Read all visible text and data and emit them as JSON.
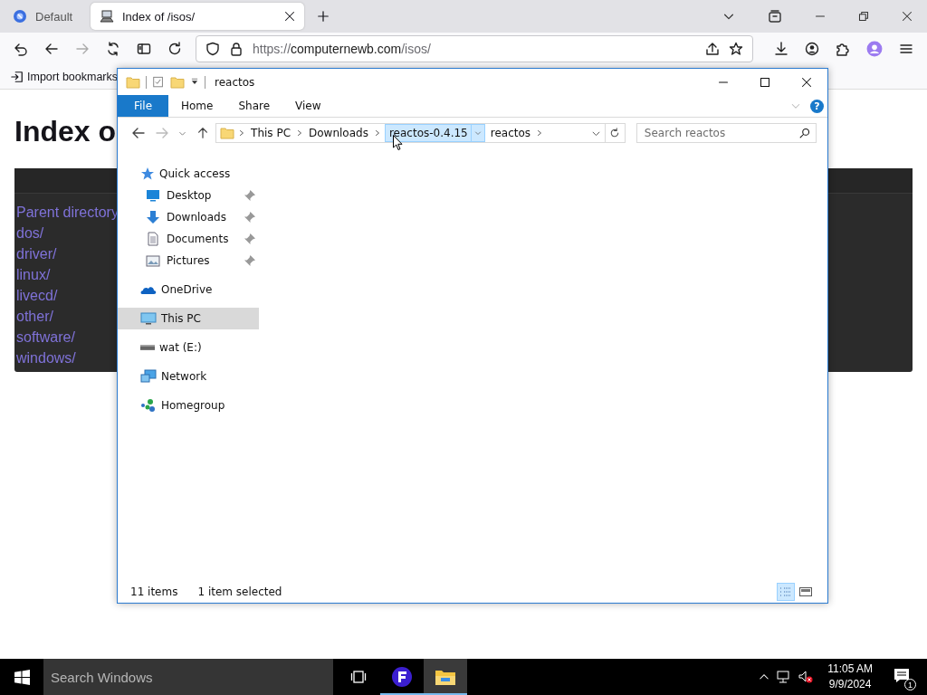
{
  "browser": {
    "tabs": [
      {
        "kind": "browser",
        "label": "Default",
        "selected": false
      },
      {
        "kind": "site",
        "label": "Index of /isos/",
        "selected": true
      }
    ],
    "nav_buttons": [
      {
        "kind": "back",
        "disabled": false
      },
      {
        "kind": "forward",
        "disabled": true
      }
    ],
    "address": {
      "scheme": "https://",
      "host": "computernewb.com",
      "path": "/isos/"
    },
    "bookmarks": [
      "Import bookmarks"
    ],
    "page": {
      "heading": "Index o",
      "links": [
        "Parent directory",
        "dos/",
        "driver/",
        "linux/",
        "livecd/",
        "other/",
        "software/",
        "windows/"
      ]
    }
  },
  "explorer": {
    "title": "reactos",
    "ribbon_tabs": [
      {
        "kind": "file",
        "label": "File"
      },
      {
        "kind": "tab",
        "label": "Home"
      },
      {
        "kind": "tab",
        "label": "Share"
      },
      {
        "kind": "tab",
        "label": "View"
      }
    ],
    "help": "?",
    "nav_buttons": [
      {
        "kind": "back",
        "disabled": false
      },
      {
        "kind": "forward",
        "disabled": true
      }
    ],
    "breadcrumb": [
      {
        "label": "This PC",
        "highlighted": false
      },
      {
        "label": "Downloads",
        "highlighted": false
      },
      {
        "label": "reactos-0.4.15",
        "highlighted": true
      },
      {
        "label": "reactos",
        "highlighted": false
      }
    ],
    "search": {
      "placeholder": "Search reactos"
    },
    "nav_pane": [
      {
        "kind": "star",
        "label": "Quick access",
        "selected": false,
        "children": [
          {
            "kind": "desktop",
            "label": "Desktop",
            "pinned": true,
            "selected": false
          },
          {
            "kind": "download",
            "label": "Downloads",
            "pinned": true,
            "selected": false
          },
          {
            "kind": "document",
            "label": "Documents",
            "pinned": true,
            "selected": false
          },
          {
            "kind": "picture",
            "label": "Pictures",
            "pinned": true,
            "selected": false
          }
        ]
      },
      {
        "kind": "cloud",
        "label": "OneDrive",
        "selected": false
      },
      {
        "kind": "computer",
        "label": "This PC",
        "selected": true
      },
      {
        "kind": "drive",
        "label": "wat (E:)",
        "selected": false
      },
      {
        "kind": "network",
        "label": "Network",
        "selected": false
      },
      {
        "kind": "homegroup",
        "label": "Homegroup",
        "selected": false
      }
    ],
    "status_bar": {
      "items": "11 items",
      "selection": "1 item selected"
    },
    "views": [
      {
        "kind": "details",
        "selected": true
      },
      {
        "kind": "large-icons",
        "selected": false
      }
    ]
  },
  "taskbar": {
    "search": {
      "placeholder": "Search Windows"
    },
    "apps": [
      {
        "kind": "task-view",
        "active": false,
        "running": false
      },
      {
        "kind": "app",
        "active": false,
        "running": true
      },
      {
        "kind": "folder",
        "active": true,
        "running": true
      }
    ],
    "clock": {
      "time": "11:05 AM",
      "date": "9/9/2024"
    },
    "notifications": "1"
  }
}
